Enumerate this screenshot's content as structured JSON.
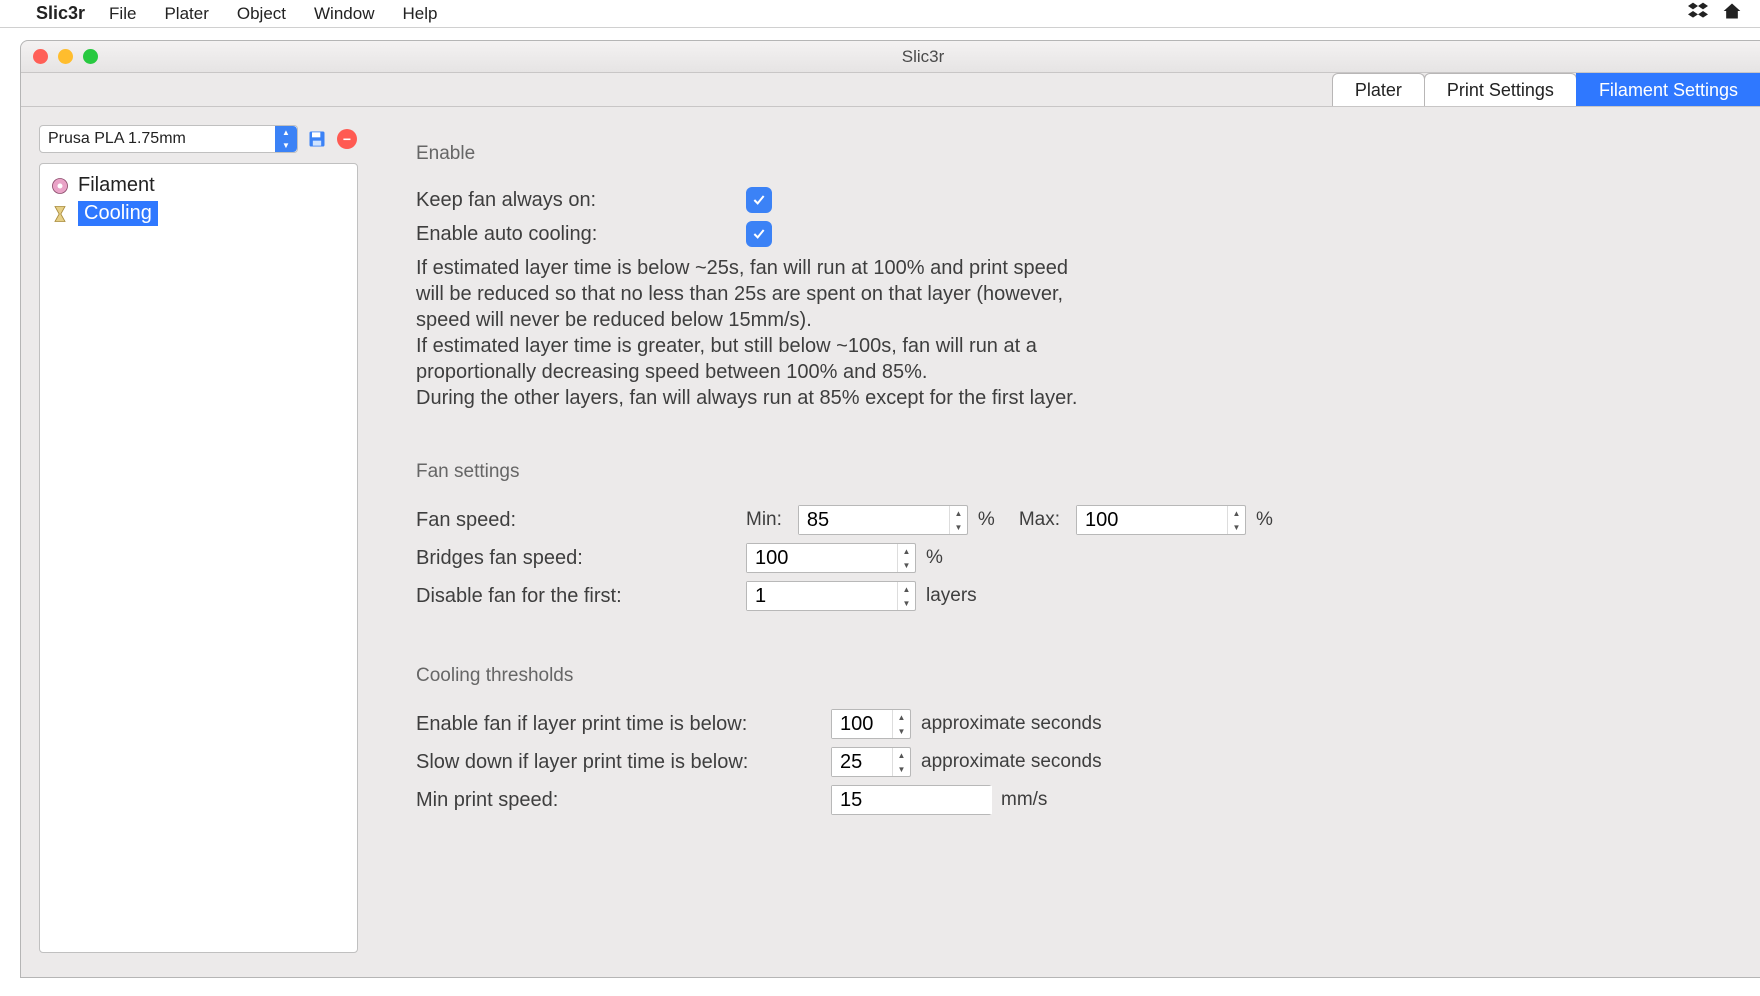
{
  "menubar": {
    "apple": "",
    "app": "Slic3r",
    "items": [
      "File",
      "Plater",
      "Object",
      "Window",
      "Help"
    ],
    "tray": [
      "⏏",
      "🏠"
    ]
  },
  "window": {
    "title": "Slic3r",
    "tabs": [
      "Plater",
      "Print Settings",
      "Filament Settings"
    ],
    "active_tab": "Filament Settings"
  },
  "sidebar": {
    "preset": "Prusa PLA 1.75mm",
    "items": [
      "Filament",
      "Cooling"
    ],
    "selected": "Cooling"
  },
  "sections": {
    "enable": {
      "title": "Enable",
      "keep_fan_label": "Keep fan always on:",
      "keep_fan_checked": true,
      "auto_cool_label": "Enable auto cooling:",
      "auto_cool_checked": true,
      "description": "If estimated layer time is below ~25s, fan will run at 100% and print speed will be reduced so that no less than 25s are spent on that layer (however, speed will never be reduced below 15mm/s).\nIf estimated layer time is greater, but still below ~100s, fan will run at a proportionally decreasing speed between 100% and 85%.\nDuring the other layers, fan will always run at 85% except for the first layer."
    },
    "fan": {
      "title": "Fan settings",
      "fan_speed_label": "Fan speed:",
      "min_label": "Min:",
      "min_value": "85",
      "min_unit": "%",
      "max_label": "Max:",
      "max_value": "100",
      "max_unit": "%",
      "bridges_label": "Bridges fan speed:",
      "bridges_value": "100",
      "bridges_unit": "%",
      "disable_label": "Disable fan for the first:",
      "disable_value": "1",
      "disable_unit": "layers"
    },
    "thresholds": {
      "title": "Cooling thresholds",
      "enable_fan_label": "Enable fan if layer print time is below:",
      "enable_fan_value": "100",
      "enable_fan_unit": "approximate seconds",
      "slowdown_label": "Slow down if layer print time is below:",
      "slowdown_value": "25",
      "slowdown_unit": "approximate seconds",
      "min_speed_label": "Min print speed:",
      "min_speed_value": "15",
      "min_speed_unit": "mm/s"
    }
  }
}
